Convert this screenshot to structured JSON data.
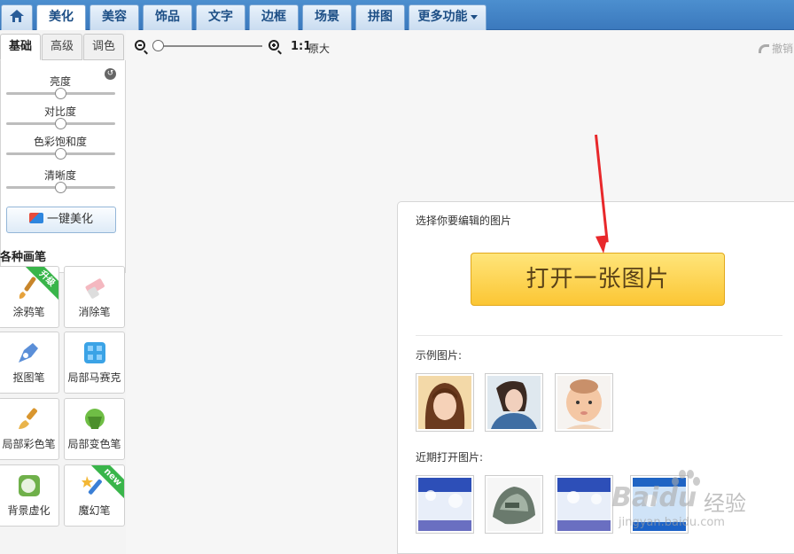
{
  "nav": {
    "tabs": [
      {
        "label": ""
      },
      {
        "label": "美化"
      },
      {
        "label": "美容"
      },
      {
        "label": "饰品"
      },
      {
        "label": "文字"
      },
      {
        "label": "边框"
      },
      {
        "label": "场景"
      },
      {
        "label": "拼图"
      },
      {
        "label": "更多功能"
      }
    ],
    "active_index": 1
  },
  "left": {
    "subtabs": [
      "基础",
      "高级",
      "调色"
    ],
    "sliders": [
      {
        "label": "亮度",
        "value": 0.5
      },
      {
        "label": "对比度",
        "value": 0.5
      },
      {
        "label": "色彩饱和度",
        "value": 0.5
      },
      {
        "label": "清晰度",
        "value": 0.5
      }
    ],
    "onekey_label": "一键美化",
    "brush_title": "各种画笔",
    "tools": [
      {
        "label": "涂鸦笔",
        "badge": "升级"
      },
      {
        "label": "消除笔",
        "badge": ""
      },
      {
        "label": "抠图笔",
        "badge": ""
      },
      {
        "label": "局部马赛克",
        "badge": ""
      },
      {
        "label": "局部彩色笔",
        "badge": ""
      },
      {
        "label": "局部变色笔",
        "badge": ""
      },
      {
        "label": "背景虚化",
        "badge": ""
      },
      {
        "label": "魔幻笔",
        "badge": "new"
      }
    ]
  },
  "zoom": {
    "ratio": "1:1",
    "original_label": "原大",
    "undo_label": "撤销",
    "level": 0
  },
  "dialog": {
    "title": "选择你要编辑的图片",
    "open_button": "打开一张图片",
    "sample_label": "示例图片:",
    "recent_label": "近期打开图片:"
  },
  "watermark": {
    "brand": "Baidu",
    "cn": "经验",
    "url": "jingyan.baidu.com"
  },
  "colors": {
    "nav_bg": "#3b79bd",
    "accent_red": "#e8282b",
    "button_yellow": "#fbc634"
  }
}
